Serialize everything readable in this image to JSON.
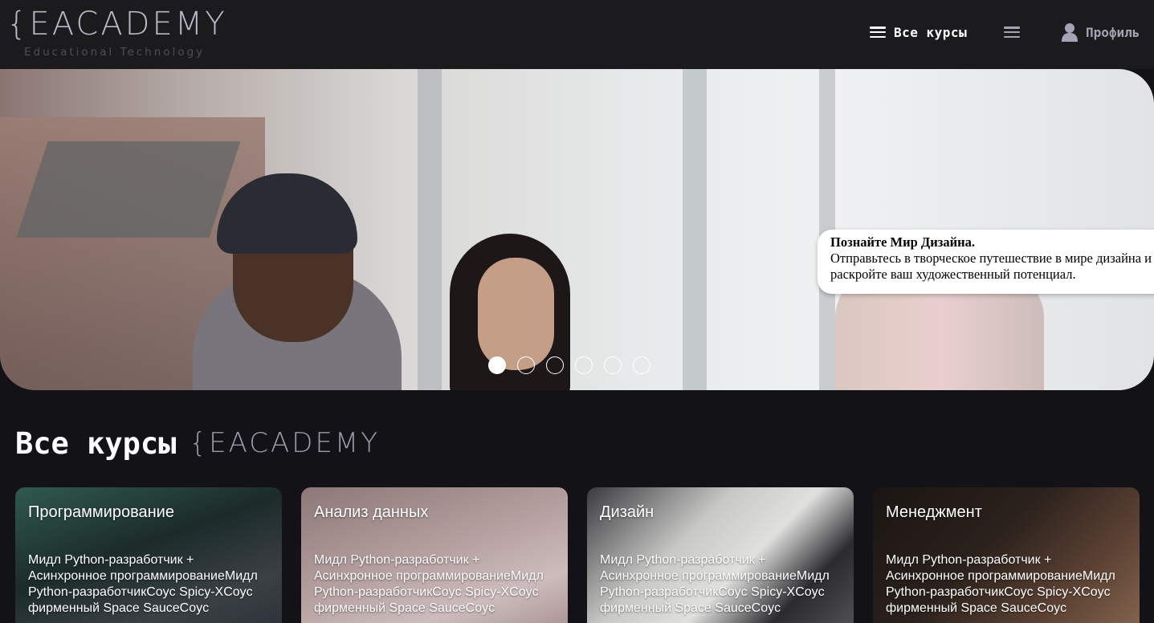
{
  "header": {
    "logo_text": "{EACADEMY",
    "logo_subtitle": "Educational Technology",
    "nav_courses_label": "Все курсы",
    "profile_label": "Профиль"
  },
  "hero": {
    "card_title": "Познайте Мир Дизайна.",
    "card_text": "Отправьтесь в творческое путешествие в мире дизайна и раскройте ваш художественный потенциал.",
    "slides_count": 6,
    "active_slide": 1
  },
  "section": {
    "title": "Все курсы",
    "brand": "{EACADEMY"
  },
  "cards": [
    {
      "title": "Программирование",
      "description": "Мидл Python-разработчик + Асинхронное программированиеМидл Python-разработчикCoyc Spicy-XCoyc фирменный Space SauceCoyc"
    },
    {
      "title": "Анализ данных",
      "description": "Мидл Python-разработчик + Асинхронное программированиеМидл Python-разработчикCoyc Spicy-XCoyc фирменный Space SauceCoyc"
    },
    {
      "title": "Дизайн",
      "description": "Мидл Python-разработчик + Асинхронное программированиеМидл Python-разработчикCoyc Spicy-XCoyc фирменный Space SauceCoyc"
    },
    {
      "title": "Менеджмент",
      "description": "Мидл Python-разработчик + Асинхронное программированиеМидл Python-разработчикCoyc Spicy-XCoyc фирменный Space SauceCoyc"
    }
  ],
  "colors": {
    "header_bg": "#1b1b1e",
    "page_bg": "#131217",
    "accent_muted": "#a6a3b6"
  },
  "icons": {
    "nav": "hamburger-icon",
    "menu": "hamburger-icon",
    "profile": "user-icon"
  }
}
